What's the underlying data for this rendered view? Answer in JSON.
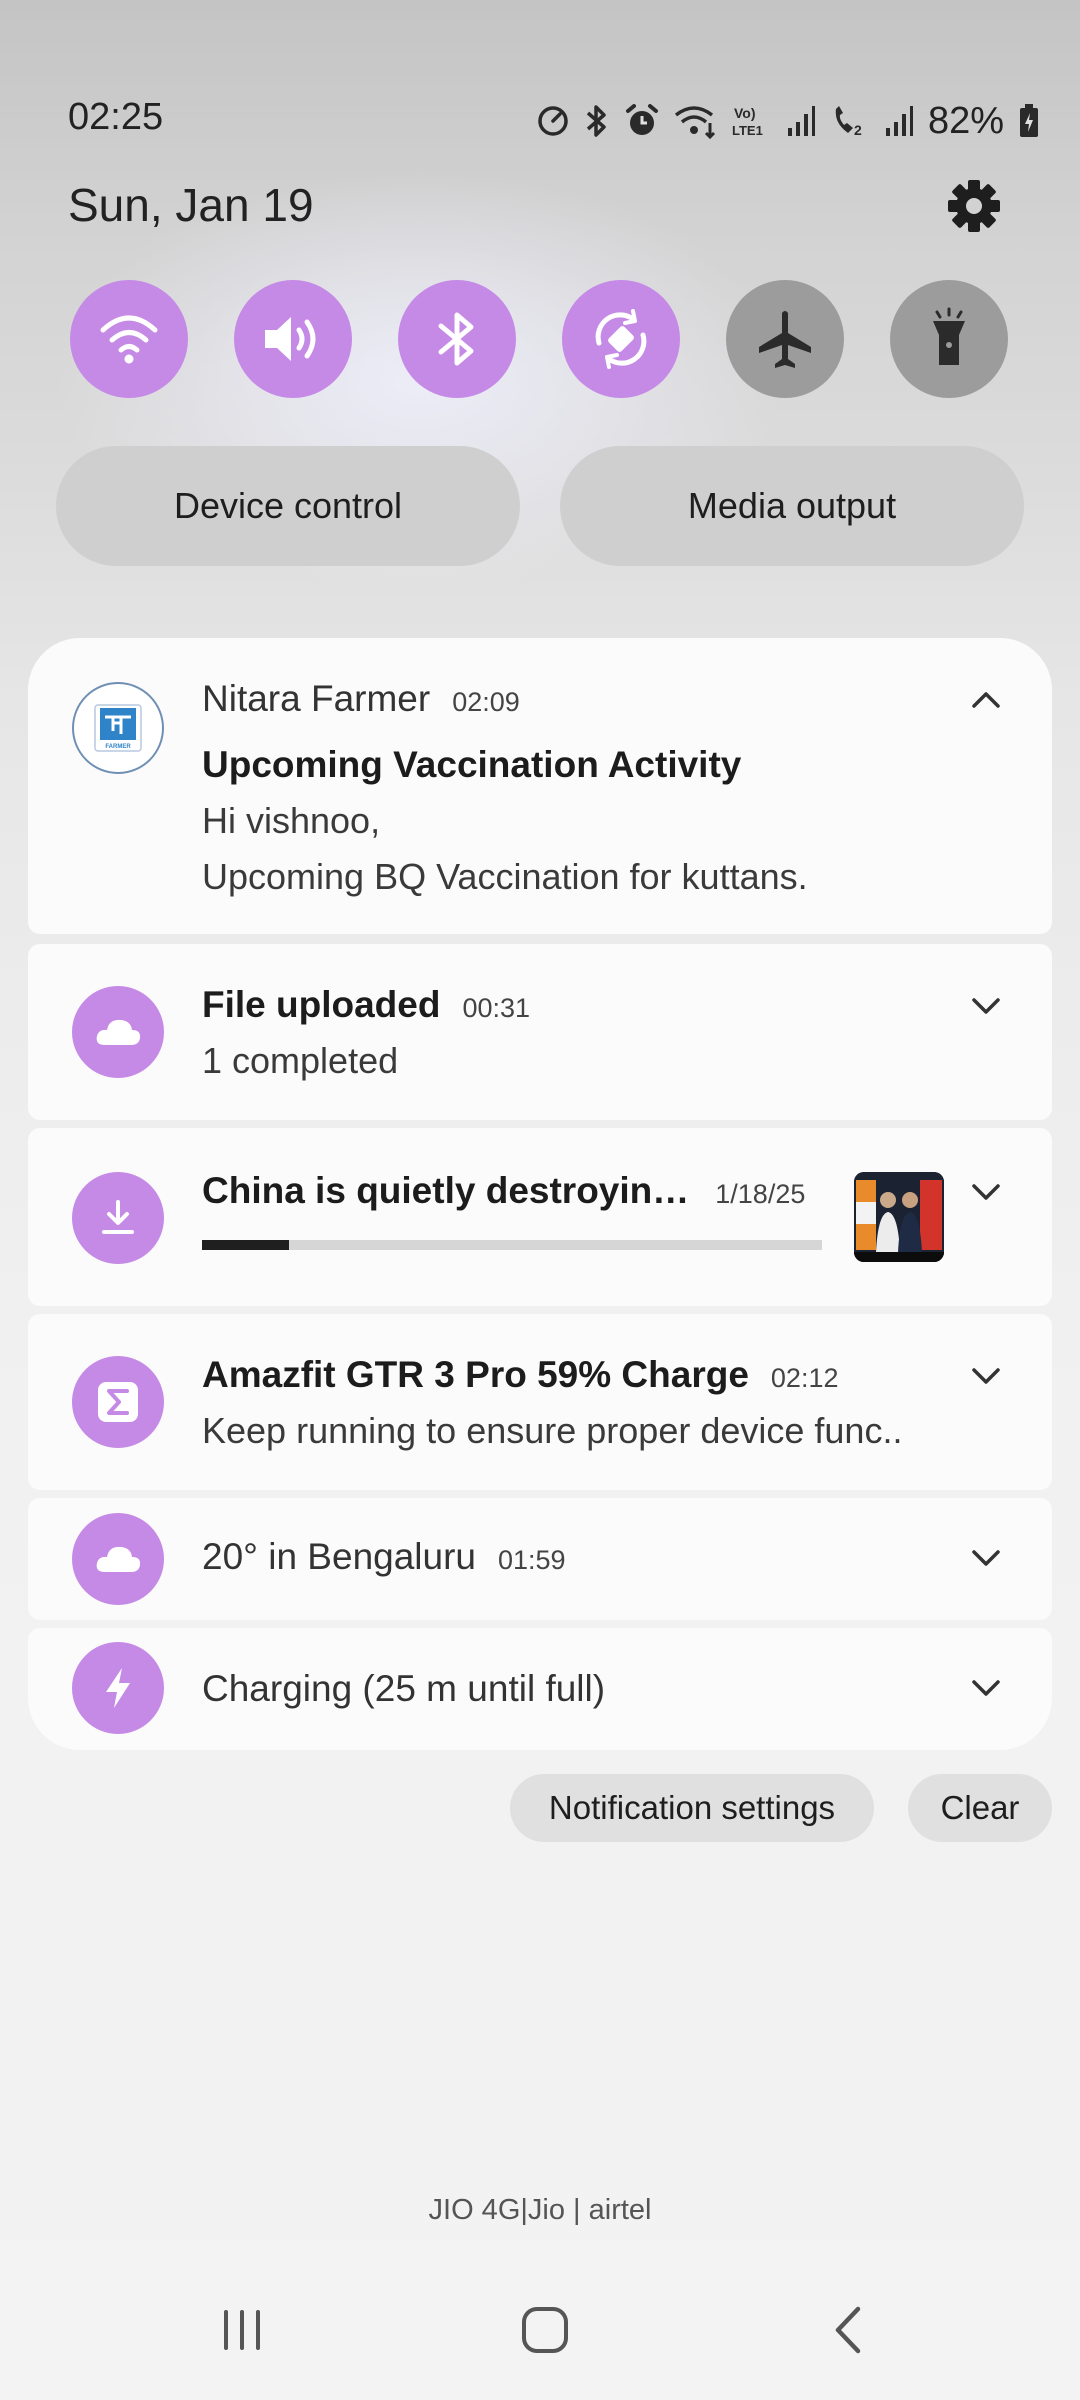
{
  "status_bar": {
    "time": "02:25",
    "battery": "82%"
  },
  "date": "Sun, Jan 19",
  "quick_toggles": [
    {
      "name": "wifi-icon",
      "state": "on"
    },
    {
      "name": "sound-icon",
      "state": "on"
    },
    {
      "name": "bluetooth-icon",
      "state": "on"
    },
    {
      "name": "auto-rotate-icon",
      "state": "on"
    },
    {
      "name": "airplane-icon",
      "state": "off"
    },
    {
      "name": "flashlight-icon",
      "state": "off"
    }
  ],
  "pills": {
    "device_control": "Device control",
    "media_output": "Media output"
  },
  "notifications": {
    "nitara": {
      "app": "Nitara Farmer",
      "time": "02:09",
      "title": "Upcoming Vaccination Activity",
      "line1": "Hi vishnoo,",
      "line2": "Upcoming BQ Vaccination for kuttans.",
      "logo_text": "FARMER"
    },
    "upload": {
      "title": "File uploaded",
      "time": "00:31",
      "body": "1 completed"
    },
    "download": {
      "title": "China is quietly destroyin…",
      "time": "1/18/25",
      "progress": 0.14
    },
    "amazfit": {
      "title": "Amazfit GTR 3 Pro 59% Charge",
      "time": "02:12",
      "body": "Keep running to ensure proper device func.."
    },
    "weather": {
      "title": "20° in Bengaluru",
      "time": "01:59"
    },
    "charging": {
      "title": "Charging (25 m until full)"
    }
  },
  "actions": {
    "notification_settings": "Notification settings",
    "clear": "Clear"
  },
  "carrier": "JIO 4G|Jio | airtel",
  "colors": {
    "accent": "#c58ae6",
    "toggle_off": "#9c9c9c",
    "card": "#fbfbfb"
  }
}
